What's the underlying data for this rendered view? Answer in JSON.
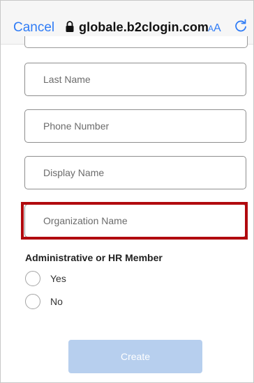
{
  "browser": {
    "cancel_label": "Cancel",
    "url": "globale.b2clogin.com",
    "text_size_label_small": "A",
    "text_size_label_large": "A",
    "link_color": "#2f7cf6"
  },
  "form": {
    "fields": [
      {
        "placeholder": "Last Name",
        "value": ""
      },
      {
        "placeholder": "Phone Number",
        "value": ""
      },
      {
        "placeholder": "Display Name",
        "value": ""
      },
      {
        "placeholder": "Organization Name",
        "value": ""
      }
    ],
    "member_section_label": "Administrative or HR Member",
    "member_options": [
      {
        "label": "Yes",
        "selected": false
      },
      {
        "label": "No",
        "selected": false
      }
    ],
    "submit_label": "Create",
    "highlight_color": "#b10a0e"
  }
}
